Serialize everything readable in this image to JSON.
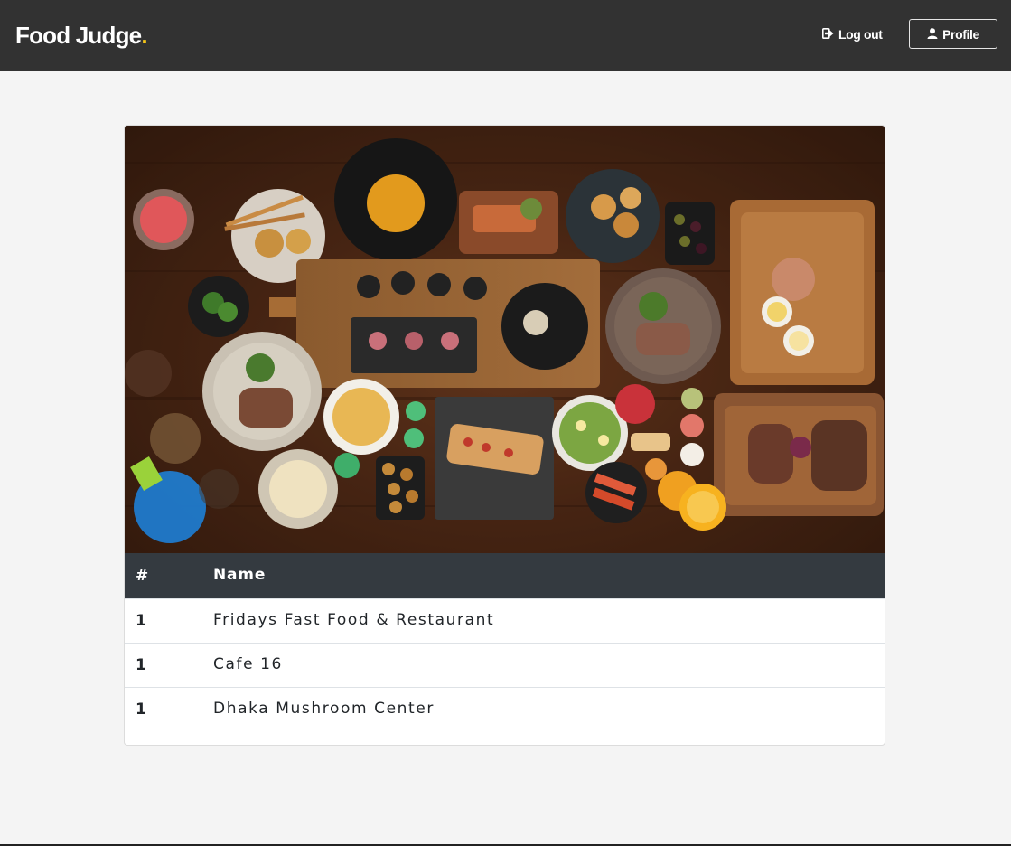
{
  "header": {
    "brand_name": "Food Judge",
    "brand_dot": ".",
    "logout_label": "Log out",
    "profile_label": "Profile",
    "brand_accent_color": "#f5c518"
  },
  "hero": {
    "image_alt": "food spread photo",
    "icon": "food-spread-photo"
  },
  "table": {
    "headers": [
      "#",
      "Name"
    ],
    "rows": [
      {
        "num": "1",
        "name": "Fridays Fast Food & Restaurant"
      },
      {
        "num": "1",
        "name": "Cafe 16"
      },
      {
        "num": "1",
        "name": "Dhaka Mushroom Center"
      }
    ]
  }
}
